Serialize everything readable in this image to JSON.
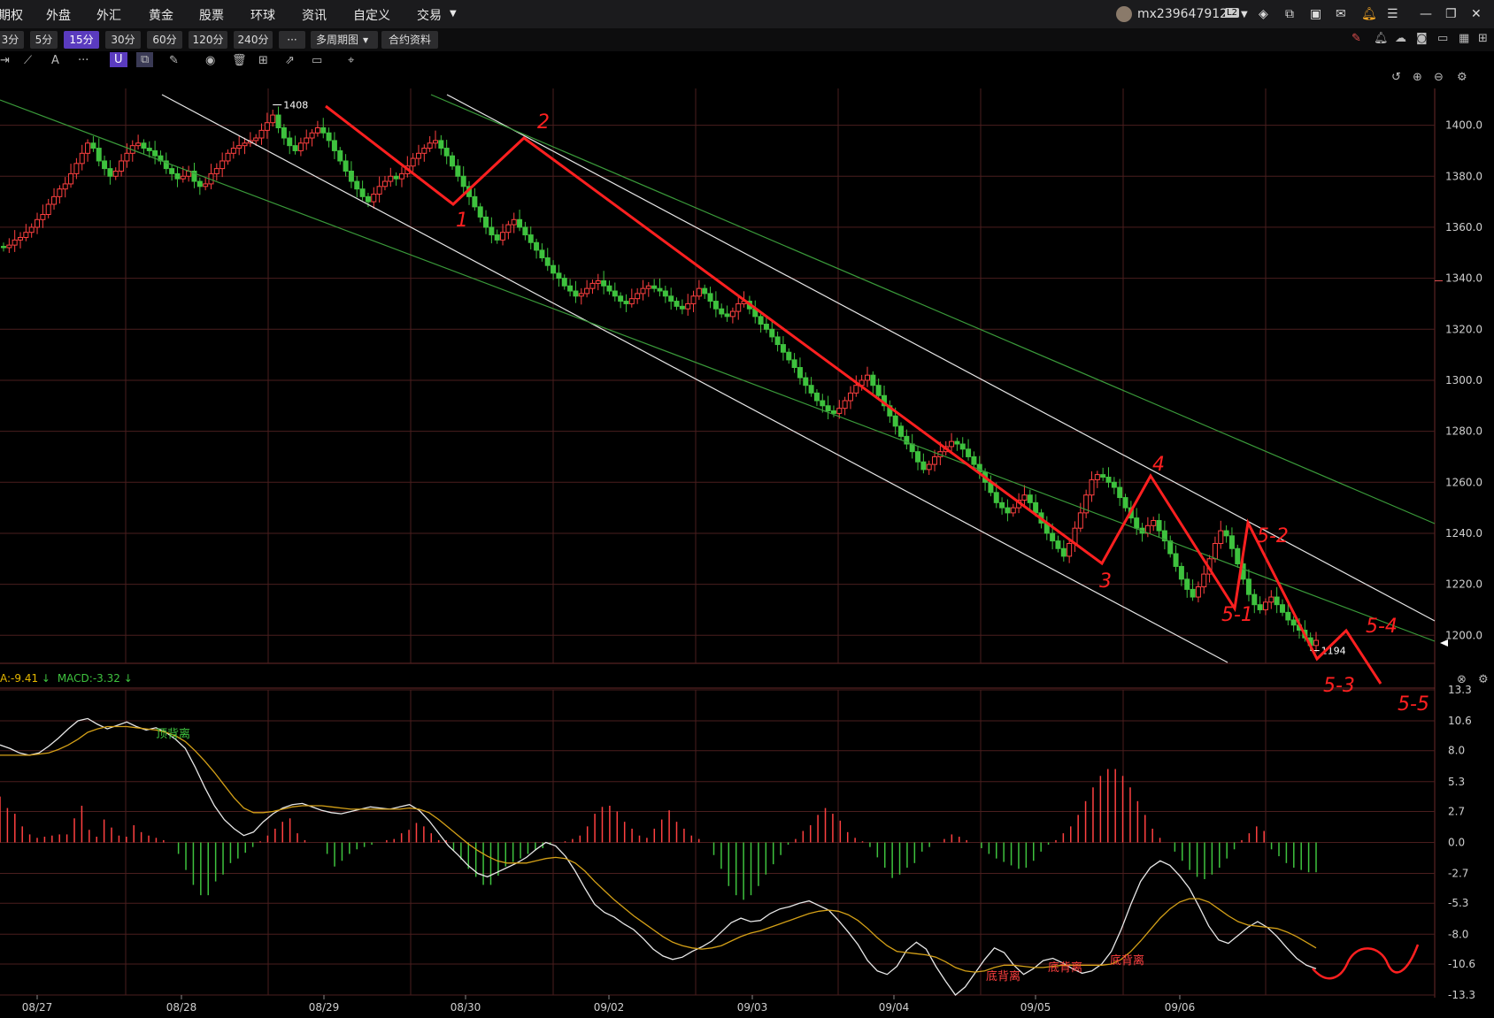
{
  "nav": {
    "items": [
      "期权",
      "外盘",
      "外汇",
      "黄金",
      "股票",
      "环球",
      "资讯",
      "自定义",
      "交易"
    ],
    "username": "mx239647912",
    "level_badge": "L2"
  },
  "periods": {
    "buttons": [
      "3分",
      "5分",
      "15分",
      "30分",
      "60分",
      "120分",
      "240分",
      "···",
      "多周期图",
      "合约资料"
    ],
    "active": "15分"
  },
  "indicator": {
    "dea_text": "A:-9.41",
    "macd_text": "MACD:-3.32"
  },
  "chart_data": [
    {
      "type": "candlestick",
      "title": "",
      "y_ticks": [
        1400,
        1380,
        1360,
        1340,
        1320,
        1300,
        1280,
        1260,
        1240,
        1220,
        1200
      ],
      "y_tick_labels": [
        "1400.0",
        "1380.0",
        "1360.0",
        "1340.0",
        "1320.0",
        "1300.0",
        "1280.0",
        "1260.0",
        "1240.0",
        "1220.0",
        "1200.0"
      ],
      "ylim": [
        1189,
        1412
      ],
      "x_labels": [
        "08/27",
        "08/28",
        "08/29",
        "08/30",
        "09/02",
        "09/03",
        "09/04",
        "09/05",
        "09/06"
      ],
      "marked_high": "1408",
      "marked_low": "1194",
      "close_series": [
        1352,
        1353,
        1355,
        1356,
        1358,
        1360,
        1363,
        1365,
        1369,
        1372,
        1375,
        1377,
        1381,
        1385,
        1389,
        1393,
        1391,
        1386,
        1383,
        1380,
        1382,
        1386,
        1389,
        1392,
        1393,
        1391,
        1390,
        1388,
        1386,
        1383,
        1381,
        1379,
        1380,
        1382,
        1378,
        1376,
        1377,
        1381,
        1383,
        1386,
        1389,
        1391,
        1392,
        1393,
        1394,
        1395,
        1398,
        1401,
        1404,
        1399,
        1395,
        1392,
        1390,
        1393,
        1395,
        1397,
        1399,
        1397,
        1394,
        1390,
        1386,
        1382,
        1378,
        1375,
        1372,
        1370,
        1373,
        1376,
        1378,
        1380,
        1379,
        1381,
        1384,
        1387,
        1389,
        1391,
        1393,
        1394,
        1391,
        1388,
        1384,
        1380,
        1376,
        1372,
        1368,
        1364,
        1360,
        1357,
        1355,
        1358,
        1361,
        1363,
        1360,
        1357,
        1354,
        1351,
        1348,
        1345,
        1342,
        1340,
        1337,
        1335,
        1333,
        1334,
        1336,
        1338,
        1339,
        1337,
        1335,
        1333,
        1331,
        1330,
        1332,
        1334,
        1336,
        1337,
        1336,
        1335,
        1333,
        1331,
        1329,
        1328,
        1330,
        1333,
        1336,
        1334,
        1331,
        1328,
        1326,
        1325,
        1327,
        1330,
        1331,
        1328,
        1325,
        1322,
        1320,
        1317,
        1314,
        1311,
        1308,
        1305,
        1301,
        1298,
        1295,
        1292,
        1290,
        1288,
        1287,
        1289,
        1292,
        1295,
        1298,
        1300,
        1302,
        1298,
        1294,
        1290,
        1286,
        1282,
        1278,
        1275,
        1272,
        1268,
        1265,
        1267,
        1270,
        1272,
        1274,
        1276,
        1275,
        1273,
        1270,
        1267,
        1264,
        1260,
        1256,
        1252,
        1250,
        1248,
        1250,
        1253,
        1255,
        1252,
        1248,
        1244,
        1240,
        1237,
        1234,
        1231,
        1236,
        1242,
        1248,
        1255,
        1261,
        1263,
        1262,
        1260,
        1258,
        1254,
        1250,
        1246,
        1242,
        1240,
        1243,
        1245,
        1241,
        1237,
        1232,
        1227,
        1222,
        1218,
        1215,
        1219,
        1224,
        1230,
        1236,
        1241,
        1239,
        1234,
        1228,
        1222,
        1216,
        1212,
        1210,
        1213,
        1215,
        1212,
        1209,
        1206,
        1204,
        1202,
        1199,
        1196,
        1198
      ]
    },
    {
      "type": "line",
      "title": "",
      "y_ticks": [
        13.3,
        10.6,
        8.0,
        5.3,
        2.7,
        0.0,
        -2.7,
        -5.3,
        -8.0,
        -10.6,
        -13.3
      ],
      "y_tick_labels": [
        "13.3",
        "10.6",
        "8.0",
        "5.3",
        "2.7",
        "0.0",
        "-2.7",
        "-5.3",
        "-8.0",
        "-10.6",
        "-13.3"
      ],
      "ylim": [
        -13.3,
        13.3
      ],
      "series": [
        {
          "values": [
            8.5,
            8.2,
            7.8,
            7.6,
            7.8,
            8.4,
            9.1,
            9.9,
            10.6,
            10.8,
            10.3,
            9.9,
            10.2,
            10.5,
            10.1,
            9.8,
            10.0,
            9.6,
            9.0,
            8.2,
            6.6,
            4.8,
            3.2,
            2.0,
            1.2,
            0.6,
            0.9,
            1.8,
            2.5,
            3.0,
            3.3,
            3.4,
            3.1,
            2.8,
            2.6,
            2.5,
            2.7,
            2.9,
            3.1,
            3.0,
            2.9,
            3.1,
            3.3,
            2.8,
            1.9,
            0.8,
            -0.3,
            -1.1,
            -2.0,
            -2.7,
            -3.0,
            -2.6,
            -2.2,
            -1.8,
            -1.3,
            -0.6,
            0.0,
            -0.3,
            -1.2,
            -2.5,
            -4.0,
            -5.4,
            -6.1,
            -6.5,
            -7.1,
            -7.6,
            -8.4,
            -9.3,
            -9.9,
            -10.2,
            -10.0,
            -9.5,
            -9.1,
            -8.6,
            -7.8,
            -7.0,
            -6.6,
            -6.9,
            -6.8,
            -6.2,
            -5.8,
            -5.6,
            -5.3,
            -5.1,
            -5.5,
            -5.9,
            -6.8,
            -7.8,
            -8.9,
            -10.3,
            -11.2,
            -11.5,
            -10.8,
            -9.4,
            -8.7,
            -9.3,
            -10.8,
            -12.1,
            -13.3,
            -12.6,
            -11.4,
            -10.2,
            -9.2,
            -9.6,
            -10.7,
            -11.5,
            -11.0,
            -10.3,
            -10.1,
            -10.5,
            -11.0,
            -11.4,
            -11.2,
            -10.6,
            -9.5,
            -7.6,
            -5.4,
            -3.4,
            -2.2,
            -1.6,
            -2.0,
            -2.9,
            -4.0,
            -5.6,
            -7.3,
            -8.5,
            -8.8,
            -8.1,
            -7.4,
            -6.9,
            -7.4,
            -8.2,
            -9.2,
            -10.1,
            -10.7,
            -11.0
          ]
        },
        {
          "values": [
            7.6,
            7.6,
            7.6,
            7.6,
            7.7,
            7.8,
            8.1,
            8.5,
            9.0,
            9.6,
            9.9,
            10.1,
            10.1,
            10.1,
            10.0,
            9.9,
            9.8,
            9.6,
            9.3,
            8.8,
            8.0,
            7.1,
            6.1,
            5.0,
            3.9,
            3.0,
            2.6,
            2.6,
            2.7,
            2.9,
            3.1,
            3.2,
            3.2,
            3.2,
            3.1,
            3.0,
            2.9,
            2.9,
            2.9,
            2.9,
            2.9,
            2.9,
            3.0,
            2.9,
            2.6,
            2.0,
            1.3,
            0.6,
            -0.1,
            -0.7,
            -1.2,
            -1.6,
            -1.8,
            -1.8,
            -1.8,
            -1.6,
            -1.4,
            -1.3,
            -1.4,
            -1.8,
            -2.5,
            -3.4,
            -4.2,
            -5.0,
            -5.7,
            -6.4,
            -7.0,
            -7.6,
            -8.2,
            -8.7,
            -9.0,
            -9.2,
            -9.3,
            -9.2,
            -9.0,
            -8.6,
            -8.2,
            -7.9,
            -7.7,
            -7.4,
            -7.1,
            -6.8,
            -6.5,
            -6.2,
            -6.0,
            -5.9,
            -6.0,
            -6.3,
            -6.8,
            -7.5,
            -8.3,
            -9.0,
            -9.5,
            -9.6,
            -9.7,
            -9.8,
            -10.0,
            -10.4,
            -10.9,
            -11.2,
            -11.3,
            -11.2,
            -10.9,
            -10.7,
            -10.7,
            -10.8,
            -10.9,
            -10.9,
            -10.8,
            -10.7,
            -10.7,
            -10.7,
            -10.7,
            -10.7,
            -10.6,
            -10.2,
            -9.5,
            -8.6,
            -7.6,
            -6.6,
            -5.8,
            -5.2,
            -4.9,
            -4.9,
            -5.2,
            -5.8,
            -6.4,
            -6.9,
            -7.2,
            -7.3,
            -7.4,
            -7.5,
            -7.8,
            -8.2,
            -8.7,
            -9.2
          ]
        }
      ],
      "bars": [
        4,
        3,
        2.5,
        1.4,
        0.7,
        0.4,
        0.5,
        0.6,
        0.7,
        0.7,
        2.1,
        3.2,
        1.1,
        0.5,
        2.0,
        1.3,
        0.6,
        0.5,
        1.5,
        0.9,
        0.6,
        0.4,
        0.2,
        0.0,
        -1.0,
        -2.4,
        -3.7,
        -4.6,
        -4.6,
        -3.4,
        -2.8,
        -1.8,
        -1.4,
        -0.9,
        -0.4,
        0.1,
        0.6,
        1.2,
        1.8,
        2.1,
        0.8,
        0.2,
        0.0,
        0.0,
        -1.0,
        -2.1,
        -1.6,
        -1.0,
        -0.6,
        -0.4,
        -0.2,
        0.0,
        0.2,
        0.3,
        0.8,
        1.1,
        1.7,
        1.4,
        0.8,
        0.2,
        0.2,
        -0.7,
        -1.5,
        -2.3,
        -3.0,
        -3.7,
        -3.7,
        -2.9,
        -2.1,
        -1.7,
        -1.4,
        -1.0,
        -0.7,
        -0.5,
        -0.2,
        0.0,
        0.1,
        0.3,
        0.6,
        1.4,
        2.5,
        3.1,
        3.2,
        2.7,
        1.8,
        1.2,
        0.6,
        0.4,
        1.2,
        2.0,
        2.8,
        1.8,
        1.2,
        0.6,
        0.3,
        0.0,
        -1.1,
        -2.3,
        -3.8,
        -4.6,
        -5.0,
        -4.6,
        -3.8,
        -2.8,
        -1.9,
        -1.1,
        -0.2,
        0.3,
        1.0,
        1.5,
        2.4,
        3.0,
        2.5,
        1.9,
        0.9,
        0.4,
        0.1,
        -0.4,
        -1.3,
        -2.2,
        -3.1,
        -2.8,
        -2.2,
        -1.8,
        -0.8,
        -0.4,
        0.0,
        0.3,
        0.7,
        0.5,
        0.2,
        0.0,
        -0.5,
        -1.0,
        -1.4,
        -1.7,
        -2.0,
        -2.3,
        -2.2,
        -1.6,
        -0.8,
        -0.2,
        0.2,
        0.8,
        1.4,
        2.4,
        3.6,
        4.8,
        5.8,
        6.4,
        6.4,
        5.8,
        4.8,
        3.6,
        2.4,
        1.2,
        0.4,
        0.0,
        -0.8,
        -1.6,
        -2.4,
        -3.0,
        -3.2,
        -2.8,
        -2.2,
        -1.4,
        -0.6,
        0.2,
        0.8,
        1.4,
        1.0,
        -0.6,
        -1.2,
        -1.8,
        -2.2,
        -2.4,
        -2.6,
        -2.6
      ],
      "annotations": [
        "顶背离",
        "底背离",
        "底背离",
        "底背离"
      ]
    }
  ],
  "wave_labels": [
    "1",
    "2",
    "3",
    "4",
    "5-1",
    "5-2",
    "5-3",
    "5-4",
    "5-5"
  ]
}
